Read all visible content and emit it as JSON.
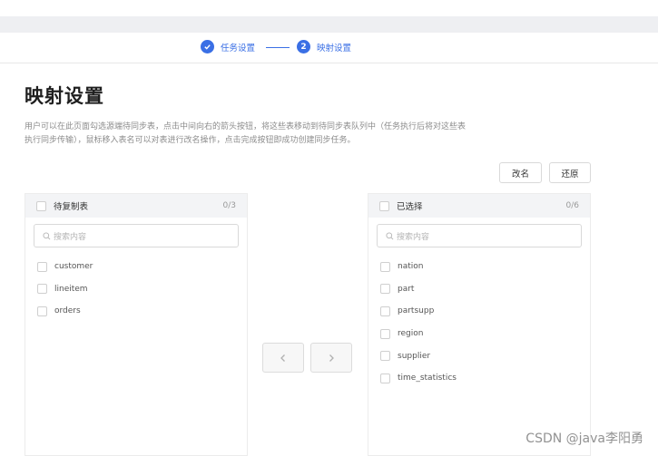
{
  "steps": [
    {
      "label": "任务设置",
      "state": "done"
    },
    {
      "label": "映射设置",
      "number": "2",
      "state": "active"
    }
  ],
  "colors": {
    "accent": "#3a6fe5",
    "panel_header": "#f3f4f6"
  },
  "page": {
    "title": "映射设置",
    "description_line1": "用户可以在此页面勾选源端待同步表，点击中间向右的箭头按钮，将这些表移动到待同步表队列中（任务执行后将对这些表",
    "description_line2": "执行同步传输），鼠标移入表名可以对表进行改名操作，点击完成按钮即成功创建同步任务。"
  },
  "actions": {
    "rename_label": "改名",
    "restore_label": "还原"
  },
  "left_panel": {
    "title": "待复制表",
    "count": "0/3",
    "search_placeholder": "搜索内容",
    "items": [
      "customer",
      "lineitem",
      "orders"
    ]
  },
  "right_panel": {
    "title": "已选择",
    "count": "0/6",
    "search_placeholder": "搜索内容",
    "items": [
      "nation",
      "part",
      "partsupp",
      "region",
      "supplier",
      "time_statistics"
    ]
  },
  "transfer": {
    "left_icon": "chevron-left-icon",
    "right_icon": "chevron-right-icon"
  },
  "watermark": "CSDN @java李阳勇"
}
